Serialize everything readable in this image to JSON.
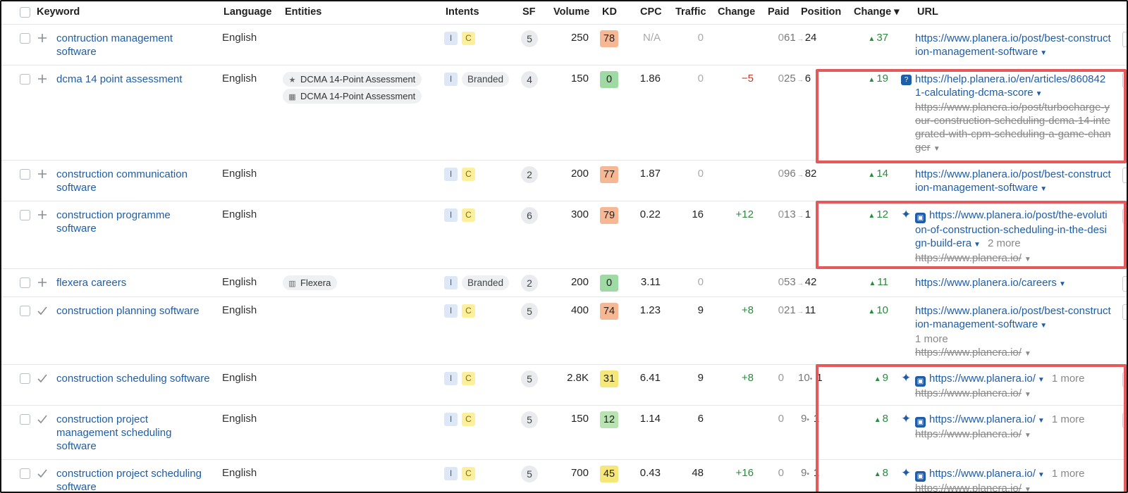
{
  "headers": {
    "keyword": "Keyword",
    "language": "Language",
    "entities": "Entities",
    "intents": "Intents",
    "sf": "SF",
    "volume": "Volume",
    "kd": "KD",
    "cpc": "CPC",
    "traffic": "Traffic",
    "change": "Change",
    "paid": "Paid",
    "position": "Position",
    "change2": "Change ▾",
    "url": "URL"
  },
  "rows": [
    {
      "keyword": "contruction management software",
      "language": "English",
      "intent_i": "I",
      "intent_c": "C",
      "sf": "5",
      "volume": "250",
      "kd": "78",
      "cpc": "N/A",
      "traffic": "0",
      "change": "",
      "paid": "0",
      "pos_old": "61",
      "pos_new": "24",
      "pos_change": "37",
      "url": "https://www.planera.io/post/best-construction-management-software"
    },
    {
      "keyword": "dcma 14 point assessment",
      "language": "English",
      "entity1": "DCMA 14-Point Assessment",
      "entity2": "DCMA 14-Point Assessment",
      "intent_i": "I",
      "intent_b": "Branded",
      "sf": "4",
      "volume": "150",
      "kd": "0",
      "cpc": "1.86",
      "traffic": "0",
      "change": "−5",
      "paid": "0",
      "pos_old": "25",
      "pos_new": "6",
      "pos_change": "19",
      "url": "https://help.planera.io/en/articles/8608421-calculating-dcma-score",
      "url_old": "https://www.planera.io/post/turbocharge-your-construction-scheduling-dcma-14-integrated-with-cpm-scheduling-a-game-changer"
    },
    {
      "keyword": "construction communication software",
      "language": "English",
      "intent_i": "I",
      "intent_c": "C",
      "sf": "2",
      "volume": "200",
      "kd": "77",
      "cpc": "1.87",
      "traffic": "0",
      "change": "",
      "paid": "0",
      "pos_old": "96",
      "pos_new": "82",
      "pos_change": "14",
      "url": "https://www.planera.io/post/best-construction-management-software"
    },
    {
      "keyword": "construction programme software",
      "language": "English",
      "intent_i": "I",
      "intent_c": "C",
      "sf": "6",
      "volume": "300",
      "kd": "79",
      "cpc": "0.22",
      "traffic": "16",
      "change": "+12",
      "paid": "0",
      "pos_old": "13",
      "pos_new": "1",
      "pos_change": "12",
      "url": "https://www.planera.io/post/the-evolution-of-construction-scheduling-in-the-design-build-era",
      "url_more": "2 more",
      "url_old": "https://www.planera.io/"
    },
    {
      "keyword": "flexera careers",
      "language": "English",
      "entity1": "Flexera",
      "intent_i": "I",
      "intent_b": "Branded",
      "sf": "2",
      "volume": "200",
      "kd": "0",
      "cpc": "3.11",
      "traffic": "0",
      "change": "",
      "paid": "0",
      "pos_old": "53",
      "pos_new": "42",
      "pos_change": "11",
      "url": "https://www.planera.io/careers"
    },
    {
      "keyword": "construction planning software",
      "language": "English",
      "intent_i": "I",
      "intent_c": "C",
      "sf": "5",
      "volume": "400",
      "kd": "74",
      "cpc": "1.23",
      "traffic": "9",
      "change": "+8",
      "paid": "0",
      "pos_old": "21",
      "pos_new": "11",
      "pos_change": "10",
      "url": "https://www.planera.io/post/best-construction-management-software",
      "url_more": "1 more",
      "url_old": "https://www.planera.io/"
    },
    {
      "keyword": "construction scheduling software",
      "language": "English",
      "intent_i": "I",
      "intent_c": "C",
      "sf": "5",
      "volume": "2.8K",
      "kd": "31",
      "cpc": "6.41",
      "traffic": "9",
      "change": "+8",
      "paid": "0",
      "pos_old": "10",
      "pos_new": "1",
      "pos_change": "9",
      "url": "https://www.planera.io/",
      "url_more": "1 more",
      "url_old": "https://www.planera.io/"
    },
    {
      "keyword": "construction project management scheduling software",
      "language": "English",
      "intent_i": "I",
      "intent_c": "C",
      "sf": "5",
      "volume": "150",
      "kd": "12",
      "cpc": "1.14",
      "traffic": "6",
      "change": "",
      "paid": "0",
      "pos_old": "9",
      "pos_new": "1",
      "pos_change": "8",
      "url": "https://www.planera.io/",
      "url_more": "1 more",
      "url_old": "https://www.planera.io/"
    },
    {
      "keyword": "construction project scheduling software",
      "language": "English",
      "intent_i": "I",
      "intent_c": "C",
      "sf": "5",
      "volume": "700",
      "kd": "45",
      "cpc": "0.43",
      "traffic": "48",
      "change": "+16",
      "paid": "0",
      "pos_old": "9",
      "pos_new": "1",
      "pos_change": "8",
      "url": "https://www.planera.io/",
      "url_more": "1 more",
      "url_old": "https://www.planera.io/"
    }
  ],
  "colors": {
    "kd_hard": "#f6b894",
    "kd_easy": "#9fd9a3",
    "kd_medium": "#f6e77a",
    "kd_easy2": "#b9e3b3",
    "positive": "#2a8a3e",
    "negative": "#c0392b",
    "highlight": "#e6595b",
    "link": "#1f5da8"
  }
}
